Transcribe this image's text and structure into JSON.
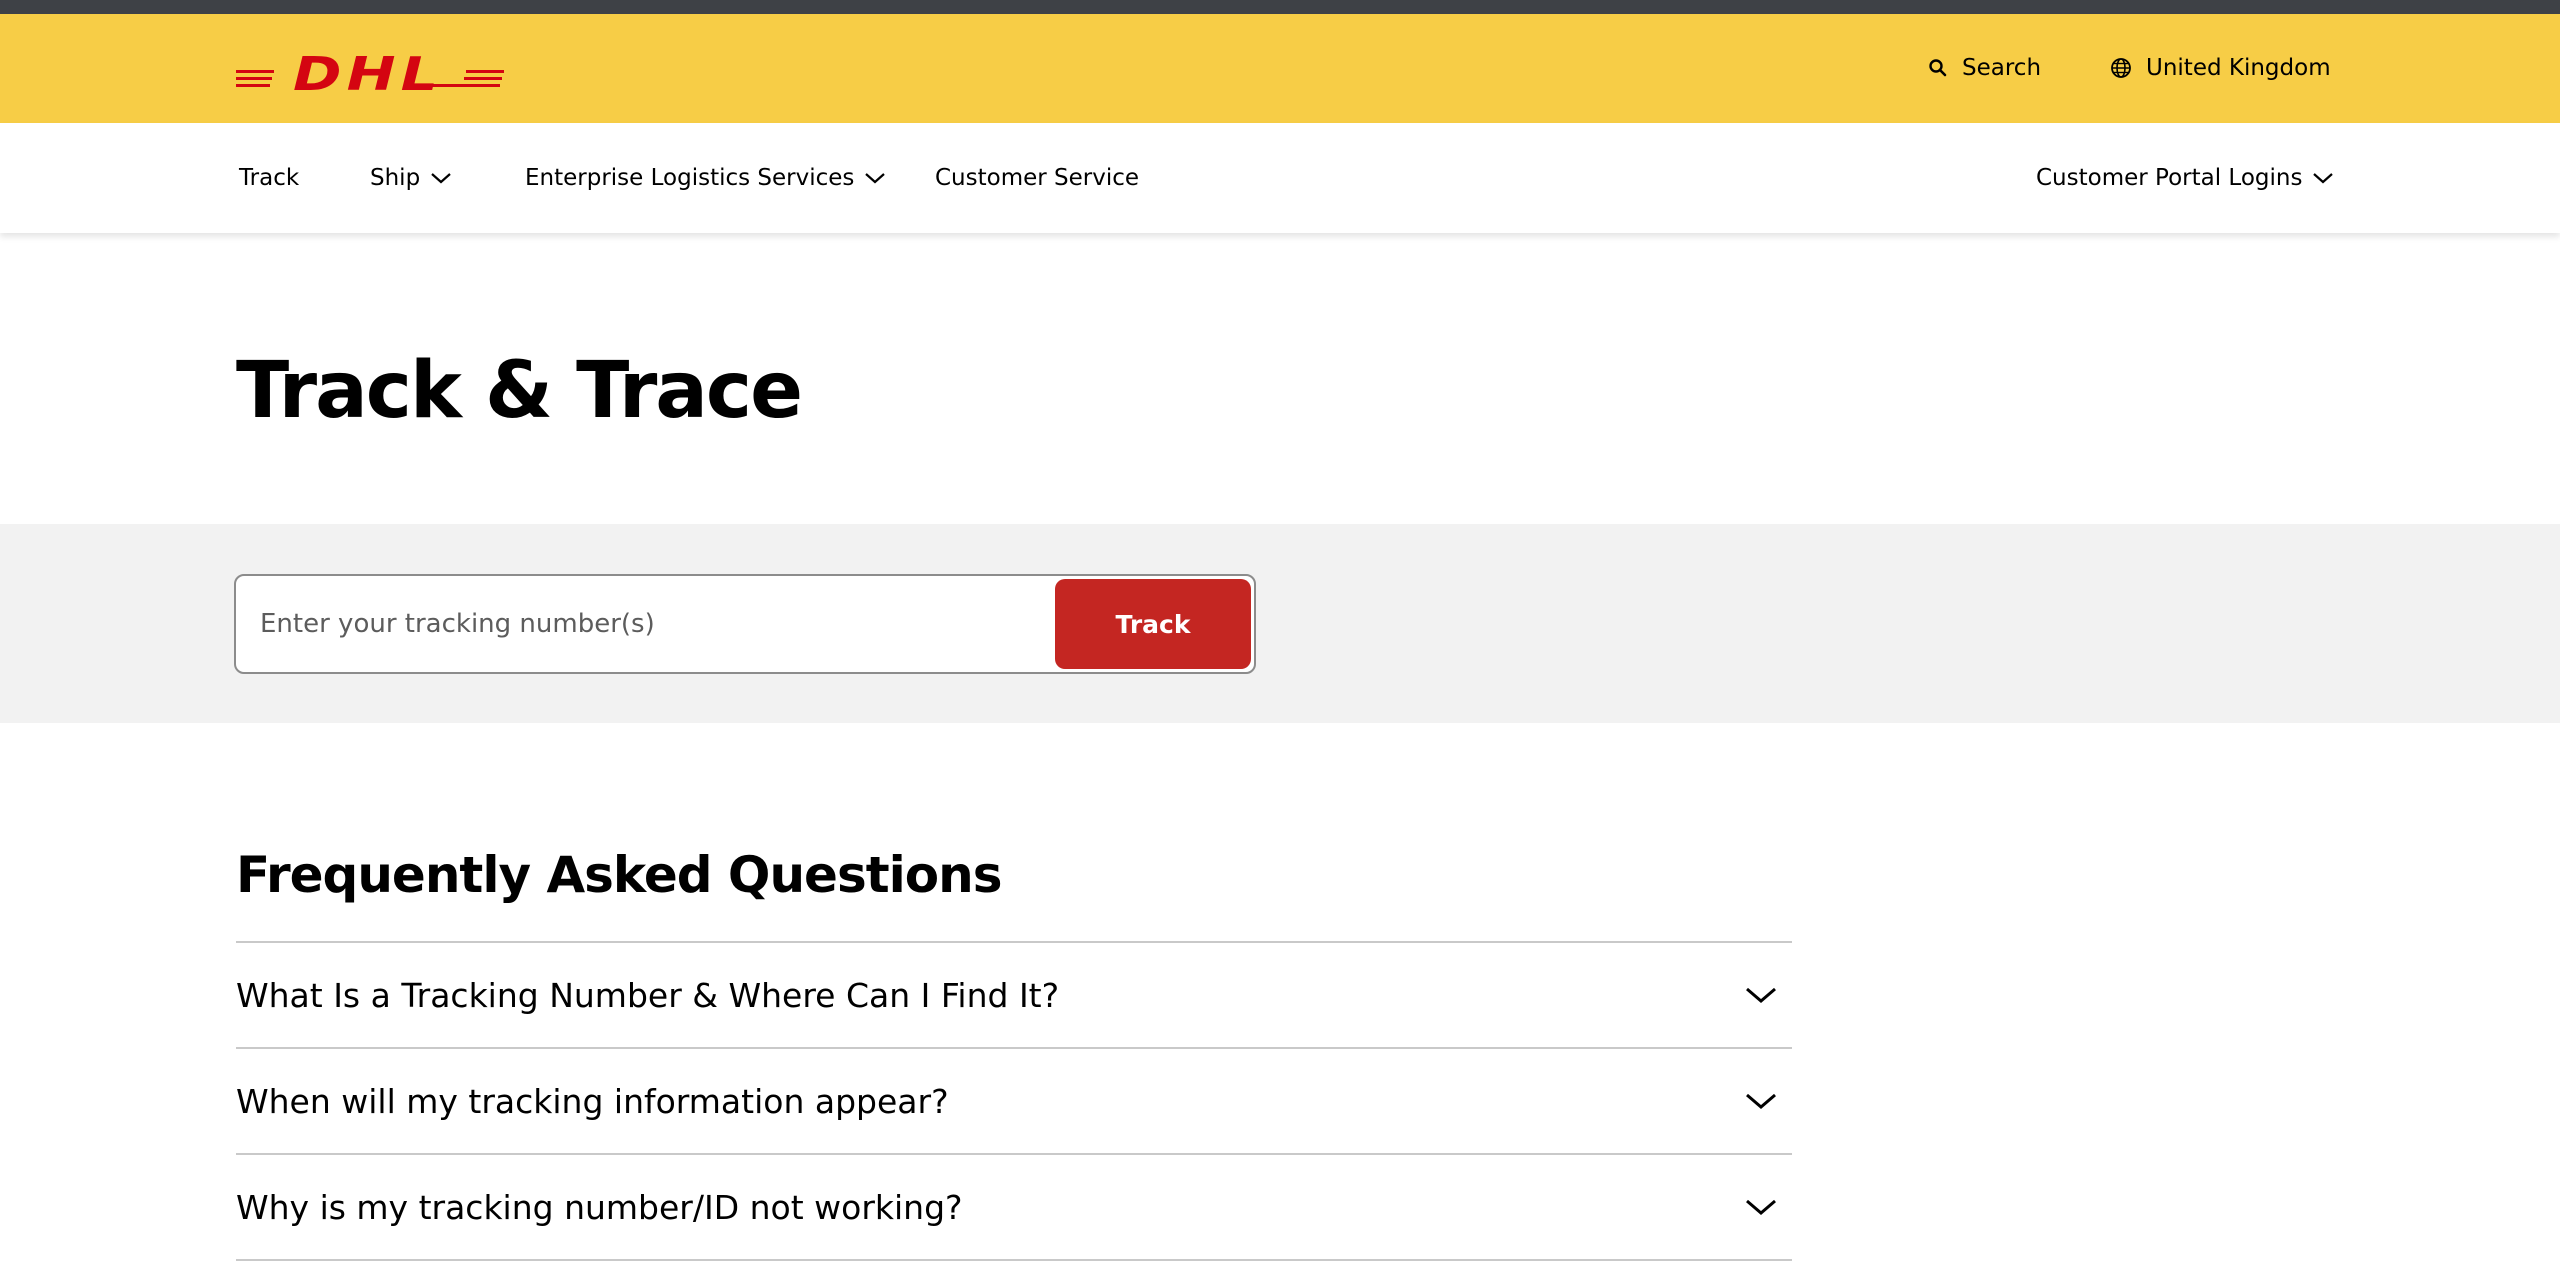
{
  "brand": {
    "logo_text": "DHL",
    "colors": {
      "header_yellow": "#f7cd46",
      "logo_red": "#d40511",
      "track_button_red": "#c42622",
      "band_gray": "#f2f2f2"
    }
  },
  "header": {
    "search_label": "Search",
    "search_icon": "search-icon",
    "country_label": "United Kingdom",
    "country_icon": "globe-icon"
  },
  "nav": {
    "items": [
      {
        "label": "Track",
        "has_dropdown": false
      },
      {
        "label": "Ship",
        "has_dropdown": true
      },
      {
        "label": "Enterprise Logistics Services",
        "has_dropdown": true
      },
      {
        "label": "Customer Service",
        "has_dropdown": false
      }
    ],
    "portal": {
      "label": "Customer Portal Logins",
      "has_dropdown": true
    }
  },
  "page": {
    "title": "Track & Trace"
  },
  "tracking": {
    "placeholder": "Enter your tracking number(s)",
    "value": "",
    "button_label": "Track"
  },
  "faq": {
    "title": "Frequently Asked Questions",
    "items": [
      {
        "question": "What Is a Tracking Number & Where Can I Find It?"
      },
      {
        "question": "When will my tracking information appear?"
      },
      {
        "question": "Why is my tracking number/ID not working?"
      }
    ]
  }
}
